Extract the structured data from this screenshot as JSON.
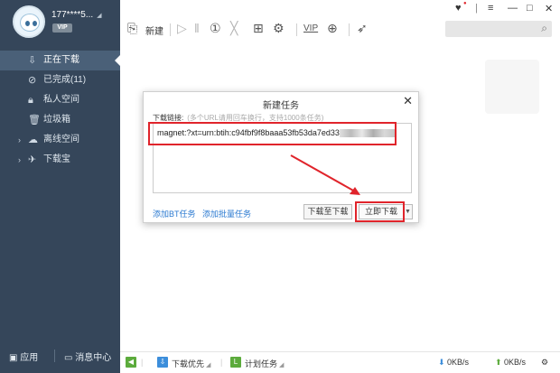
{
  "user": {
    "name": "177****5...",
    "vip_badge": "VIP"
  },
  "sidebar": {
    "items": [
      {
        "label": "正在下载",
        "icon": "download-icon",
        "active": true
      },
      {
        "label": "已完成(11)",
        "icon": "check-circle-icon"
      },
      {
        "label": "私人空间",
        "icon": "lock-icon"
      },
      {
        "label": "垃圾箱",
        "icon": "trash-icon"
      },
      {
        "label": "离线空间",
        "icon": "cloud-icon",
        "expandable": true
      },
      {
        "label": "下载宝",
        "icon": "router-icon",
        "expandable": true
      }
    ],
    "bottom": {
      "apps": "应用",
      "messages": "消息中心"
    }
  },
  "toolbar": {
    "new_label": "新建"
  },
  "dialog": {
    "title": "新建任务",
    "link_label": "下载链接:",
    "link_hint": "(多个URL请用回车换行，支持1000条任务)",
    "link_value": "magnet:?xt=urn:btih:c94fbf9f8baaa53fb53da7ed33",
    "add_bt": "添加BT任务",
    "add_batch": "添加批量任务",
    "download_later": "下载至下载",
    "download_now": "立即下载"
  },
  "statusbar": {
    "priority": "下载优先",
    "scheduled": "计划任务",
    "down_speed": "0KB/s",
    "up_speed": "0KB/s"
  },
  "colors": {
    "sidebar_bg": "#35465a",
    "highlight": "#e0242b",
    "link": "#2b7ad1"
  }
}
